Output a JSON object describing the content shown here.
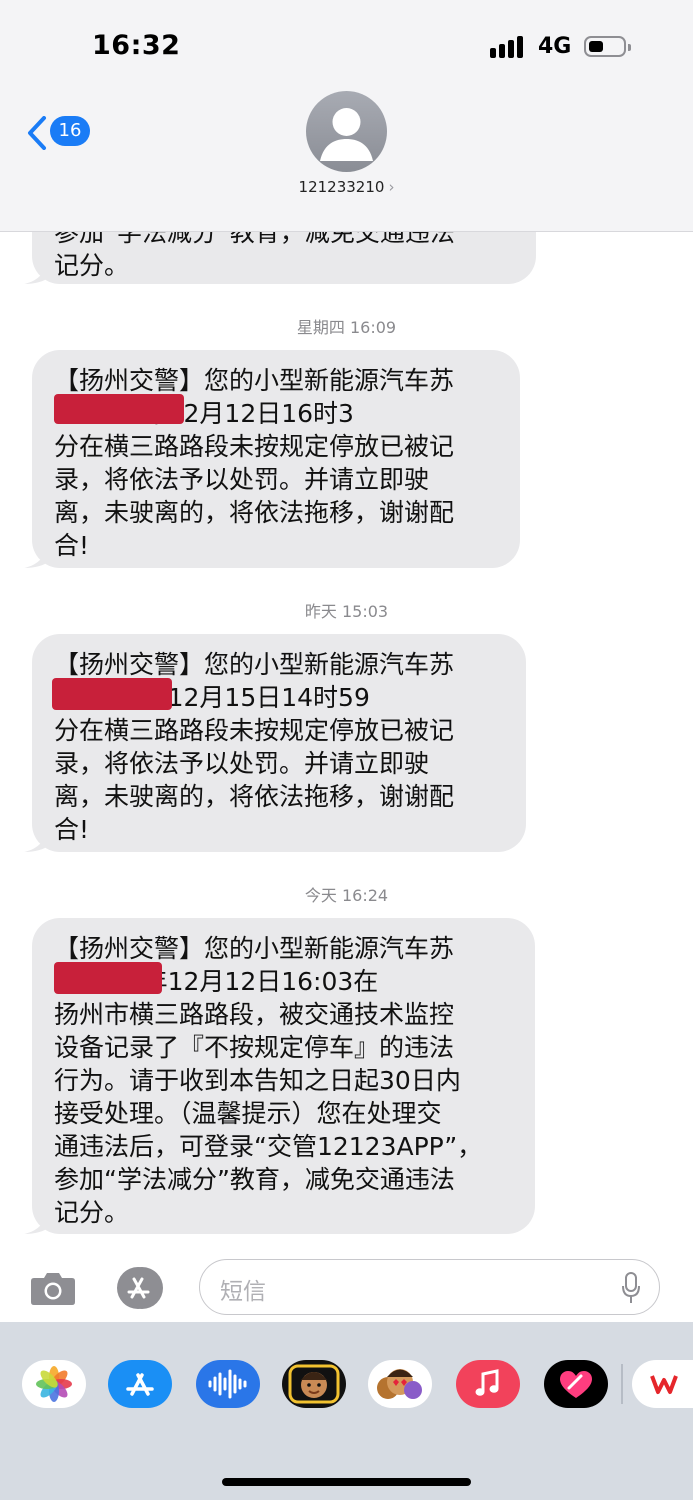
{
  "status_bar": {
    "time": "16:32",
    "network": "4G"
  },
  "header": {
    "back_count": "16",
    "contact_number": "121233210",
    "contact_chevron": "›"
  },
  "messages": [
    {
      "text": "参加“学法减分”教育，减免交通违法\n记分。"
    },
    {
      "timestamp": "星期四 16:09",
      "text": "【扬州交警】您的小型新能源汽车苏\n        于2024年12月12日16时3\n分在横三路路段未按规定停放已被记\n录，将依法予以处罚。并请立即驶\n离，未驶离的，将依法拖移，谢谢配\n合!"
    },
    {
      "timestamp": "昨天 15:03",
      "text": "【扬州交警】您的小型新能源汽车苏\n         于2024年12月15日14时59\n分在横三路路段未按规定停放已被记\n录，将依法予以处罚。并请立即驶\n离，未驶离的，将依法拖移，谢谢配\n合!"
    },
    {
      "timestamp": "今天 16:24",
      "text": "【扬州交警】您的小型新能源汽车苏\n         于2024年12月12日16:03在\n扬州市横三路路段，被交通技术监控\n设备记录了『不按规定停车』的违法\n行为。请于收到本告知之日起30日内\n接受处理。（温馨提示）您在处理交\n通违法后，可登录“交管12123APP”，\n参加“学法减分”教育，减免交通违法\n记分。"
    }
  ],
  "input": {
    "placeholder": "短信"
  },
  "colors": {
    "bubble": "#e9e9eb",
    "accent": "#1a7cf6",
    "redaction": "#c8203a"
  },
  "app_drawer": [
    "photos-icon",
    "app-store-icon",
    "audio-message-icon",
    "memoji-icon",
    "memoji-stickers-icon",
    "music-icon",
    "digital-touch-icon",
    "wps-icon"
  ]
}
